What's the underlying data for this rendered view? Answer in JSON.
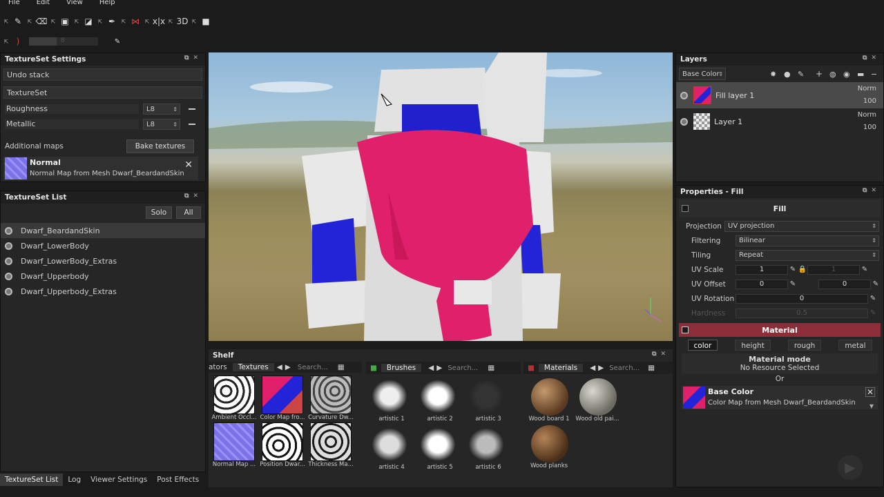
{
  "menu": {
    "file": "File",
    "edit": "Edit",
    "view": "View",
    "help": "Help"
  },
  "toolbar2": {
    "size_value": "8"
  },
  "textureset_settings": {
    "title": "TextureSet Settings",
    "undo_stack": "Undo stack",
    "textureset": "TextureSet",
    "roughness_label": "Roughness",
    "roughness_format": "L8",
    "metallic_label": "Metallic",
    "metallic_format": "L8",
    "additional_maps": "Additional maps",
    "bake_textures": "Bake textures",
    "normal_title": "Normal",
    "normal_desc": "Normal Map from Mesh Dwarf_BeardandSkin"
  },
  "textureset_list": {
    "title": "TextureSet List",
    "solo": "Solo",
    "all": "All",
    "items": [
      "Dwarf_BeardandSkin",
      "Dwarf_LowerBody",
      "Dwarf_LowerBody_Extras",
      "Dwarf_Upperbody",
      "Dwarf_Upperbody_Extras"
    ]
  },
  "bottom_tabs": {
    "t1": "TextureSet List",
    "t2": "Log",
    "t3": "Viewer Settings",
    "t4": "Post Effects"
  },
  "shelf": {
    "title": "Shelf",
    "tab_prev": "ators",
    "textures_tab": "Textures",
    "brushes_tab": "Brushes",
    "materials_tab": "Materials",
    "search_placeholder": "Search...",
    "textures": [
      "Ambient Occl...",
      "Color Map fro...",
      "Curvature Dw...",
      "Normal Map ...",
      "Position Dwar...",
      "Thickness Ma..."
    ],
    "brushes": [
      "artistic 1",
      "artistic 2",
      "artistic 3",
      "artistic 4",
      "artistic 5",
      "artistic 6"
    ],
    "materials": [
      "Wood board 1",
      "Wood old pai...",
      "Wood planks"
    ]
  },
  "layers": {
    "title": "Layers",
    "channel": "Base Color",
    "items": [
      {
        "name": "Fill layer 1",
        "blend": "Norm",
        "opacity": "100"
      },
      {
        "name": "Layer 1",
        "blend": "Norm",
        "opacity": "100"
      }
    ]
  },
  "properties": {
    "title": "Properties - Fill",
    "fill": "Fill",
    "projection_label": "Projection",
    "projection_value": "UV projection",
    "filtering_label": "Filtering",
    "filtering_value": "Bilinear",
    "tiling_label": "Tiling",
    "tiling_value": "Repeat",
    "uvscale_label": "UV Scale",
    "uvscale_a": "1",
    "uvscale_b": "1",
    "uvoffset_label": "UV Offset",
    "uvoffset_a": "0",
    "uvoffset_b": "0",
    "uvrotation_label": "UV Rotation",
    "uvrotation_value": "0",
    "hardness_label": "Hardness",
    "hardness_value": "0.5",
    "material": "Material",
    "channels": {
      "color": "color",
      "height": "height",
      "rough": "rough",
      "metal": "metal"
    },
    "material_mode": "Material mode",
    "no_resource": "No Resource Selected",
    "or": "Or",
    "base_color_title": "Base Color",
    "base_color_desc": "Color Map from Mesh Dwarf_BeardandSkin"
  },
  "colors": {
    "accent_red": "#8c2d3a",
    "beard_pink": "#e0206a",
    "skin_blue": "#1a1acc"
  }
}
